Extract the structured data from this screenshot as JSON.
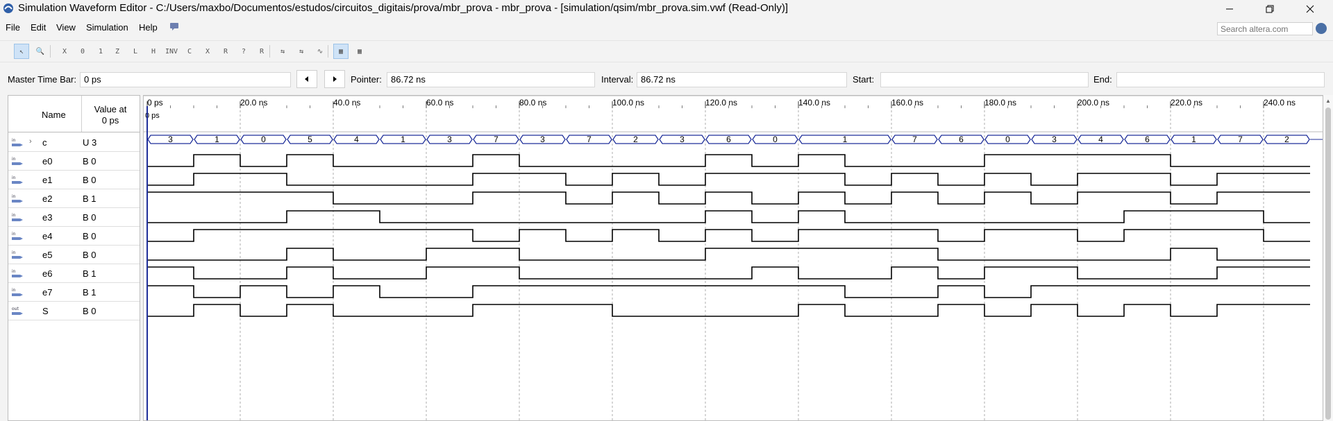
{
  "window": {
    "title": "Simulation Waveform Editor - C:/Users/maxbo/Documentos/estudos/circuitos_digitais/prova/mbr_prova - mbr_prova - [simulation/qsim/mbr_prova.sim.vwf (Read-Only)]"
  },
  "menu": [
    "File",
    "Edit",
    "View",
    "Simulation",
    "Help"
  ],
  "search": {
    "placeholder": "Search altera.com"
  },
  "timebar": {
    "master_label": "Master Time Bar:",
    "master_value": "0 ps",
    "pointer_label": "Pointer:",
    "pointer_value": "86.72 ns",
    "interval_label": "Interval:",
    "interval_value": "86.72 ns",
    "start_label": "Start:",
    "start_value": "",
    "end_label": "End:",
    "end_value": ""
  },
  "header": {
    "name": "Name",
    "value_at_line1": "Value at",
    "value_at_line2": "0 ps"
  },
  "time_ticks": [
    "0 ps",
    "20.0 ns",
    "40.0 ns",
    "60.0 ns",
    "80.0 ns",
    "100.0 ns",
    "120.0 ns",
    "140.0 ns",
    "160.0 ns",
    "180.0 ns",
    "200.0 ns",
    "220.0 ns",
    "240.0 ns"
  ],
  "cursor_label": "0 ps",
  "signals": [
    {
      "name": "c",
      "value": "U 3",
      "dir": "in",
      "bus": true
    },
    {
      "name": "e0",
      "value": "B 0",
      "dir": "in",
      "bus": false
    },
    {
      "name": "e1",
      "value": "B 0",
      "dir": "in",
      "bus": false
    },
    {
      "name": "e2",
      "value": "B 1",
      "dir": "in",
      "bus": false
    },
    {
      "name": "e3",
      "value": "B 0",
      "dir": "in",
      "bus": false
    },
    {
      "name": "e4",
      "value": "B 0",
      "dir": "in",
      "bus": false
    },
    {
      "name": "e5",
      "value": "B 0",
      "dir": "in",
      "bus": false
    },
    {
      "name": "e6",
      "value": "B 1",
      "dir": "in",
      "bus": false
    },
    {
      "name": "e7",
      "value": "B 1",
      "dir": "in",
      "bus": false
    },
    {
      "name": "S",
      "value": "B 0",
      "dir": "out",
      "bus": false
    }
  ],
  "waveforms": {
    "time_step_ns": 10,
    "c": {
      "values": [
        "3",
        "1",
        "0",
        "5",
        "4",
        "1",
        "3",
        "7",
        "3",
        "7",
        "2",
        "3",
        "6",
        "0",
        "1",
        "7",
        "6",
        "0",
        "3",
        "4",
        "6",
        "1",
        "7",
        "2"
      ],
      "durations": [
        10,
        10,
        10,
        10,
        10,
        10,
        10,
        10,
        10,
        10,
        10,
        10,
        10,
        10,
        20,
        10,
        10,
        10,
        10,
        10,
        10,
        10,
        10,
        10
      ]
    },
    "e0": [
      0,
      1,
      0,
      1,
      0,
      0,
      0,
      1,
      0,
      0,
      0,
      0,
      1,
      0,
      1,
      0,
      0,
      0,
      1,
      1,
      1,
      1,
      0,
      0,
      0
    ],
    "e1": [
      0,
      1,
      1,
      0,
      0,
      0,
      0,
      1,
      1,
      0,
      1,
      0,
      1,
      1,
      1,
      0,
      1,
      0,
      1,
      0,
      1,
      1,
      0,
      1,
      1
    ],
    "e2": [
      1,
      1,
      1,
      1,
      0,
      0,
      0,
      1,
      1,
      0,
      1,
      0,
      1,
      0,
      1,
      0,
      1,
      0,
      1,
      0,
      1,
      1,
      0,
      1,
      1
    ],
    "e3": [
      0,
      0,
      0,
      1,
      1,
      0,
      0,
      0,
      0,
      0,
      0,
      0,
      1,
      0,
      1,
      0,
      0,
      0,
      0,
      0,
      0,
      1,
      1,
      1,
      0
    ],
    "e4": [
      0,
      1,
      1,
      1,
      1,
      1,
      1,
      0,
      1,
      0,
      1,
      0,
      1,
      0,
      1,
      1,
      1,
      0,
      1,
      1,
      0,
      1,
      1,
      1,
      0
    ],
    "e5": [
      0,
      0,
      0,
      1,
      0,
      0,
      1,
      1,
      0,
      0,
      0,
      0,
      1,
      1,
      1,
      1,
      1,
      0,
      0,
      0,
      0,
      0,
      1,
      0,
      0
    ],
    "e6": [
      1,
      0,
      0,
      1,
      0,
      0,
      1,
      1,
      0,
      0,
      0,
      0,
      0,
      1,
      0,
      0,
      1,
      0,
      1,
      1,
      0,
      0,
      0,
      1,
      1
    ],
    "e7": [
      1,
      0,
      1,
      0,
      1,
      0,
      0,
      1,
      1,
      1,
      1,
      1,
      1,
      1,
      1,
      0,
      0,
      1,
      0,
      1,
      1,
      1,
      1,
      1,
      1
    ],
    "S": [
      0,
      1,
      0,
      1,
      0,
      0,
      0,
      1,
      1,
      1,
      0,
      0,
      0,
      0,
      1,
      0,
      0,
      1,
      0,
      1,
      0,
      1,
      0,
      1,
      1
    ]
  },
  "colors": {
    "bus": "#1f2f9a",
    "wave": "#000000",
    "grid": "#9a9a9a",
    "cursor": "#1f2f9a"
  },
  "icons": {
    "toolbar": [
      "selection-tool-icon",
      "zoom-tool-icon",
      "forcing-unknown-icon",
      "forcing-low-icon",
      "forcing-high-icon",
      "high-impedance-icon",
      "weak-low-icon",
      "weak-high-icon",
      "invert-icon",
      "count-value-icon",
      "clock-icon",
      "random-value-icon",
      "dont-care-icon",
      "arbitrary-value-icon",
      "snap-to-grid-icon",
      "grid-settings-icon",
      "waveform-editing-icon",
      "show-as-table-icon",
      "edit-group-icon"
    ]
  }
}
